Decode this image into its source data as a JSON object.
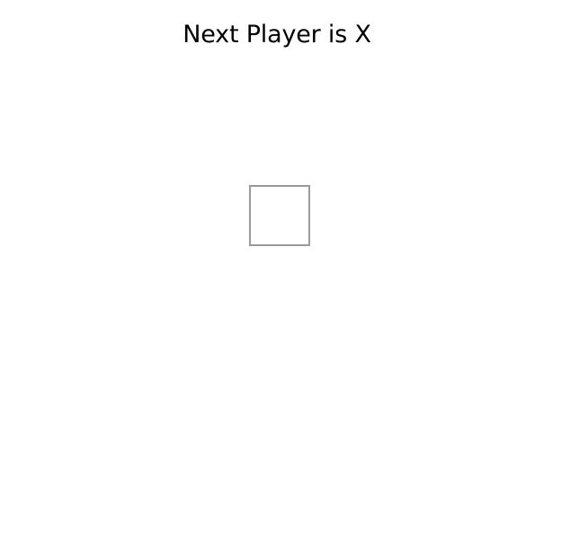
{
  "status": {
    "text": "Next Player is X"
  },
  "board": {
    "squares": [
      ""
    ],
    "square_border_color": "#9a9a9a"
  }
}
